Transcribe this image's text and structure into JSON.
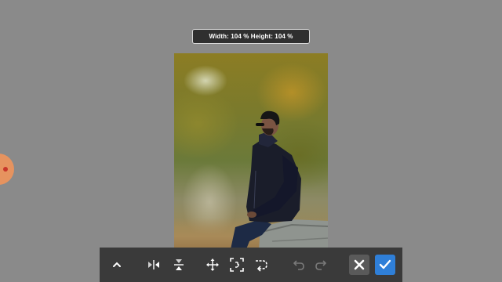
{
  "transform": {
    "size_readout": "Width: 104 % Height: 104 %"
  },
  "toolbar": {
    "items": [
      {
        "icon": "chevron-up-icon",
        "label": "collapse"
      },
      {
        "icon": "flip-horizontal-icon",
        "label": "flip horizontal"
      },
      {
        "icon": "flip-vertical-icon",
        "label": "flip vertical"
      },
      {
        "icon": "move-arrows-icon",
        "label": "move"
      },
      {
        "icon": "fit-frame-icon",
        "label": "fit"
      },
      {
        "icon": "rotate-icon",
        "label": "rotate"
      },
      {
        "icon": "undo-icon",
        "label": "undo",
        "disabled": true
      },
      {
        "icon": "redo-icon",
        "label": "redo",
        "disabled": true
      },
      {
        "icon": "close-icon",
        "label": "cancel"
      },
      {
        "icon": "check-icon",
        "label": "apply"
      }
    ]
  },
  "colors": {
    "canvas_bg": "#8a8a8a",
    "toolbar_bg": "#3a3a3a",
    "confirm": "#2f7fd8",
    "handle": "#e6935f"
  }
}
